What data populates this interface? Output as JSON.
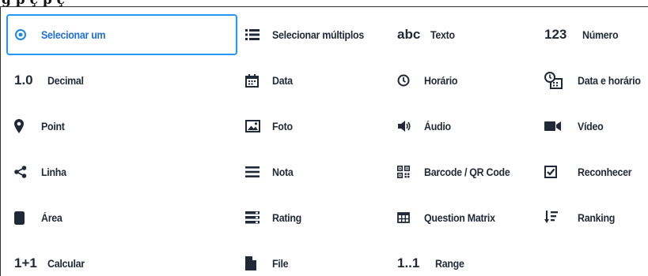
{
  "heading": "g                   p ç   p                     ç",
  "fields": [
    {
      "label": "Selecionar um",
      "icon": "radio-selected-icon",
      "selected": true
    },
    {
      "label": "Selecionar múltiplos",
      "icon": "list-icon"
    },
    {
      "label": "Texto",
      "icon": "text-abc-icon",
      "icon_text": "abc"
    },
    {
      "label": "Número",
      "icon": "number-123-icon",
      "icon_text": "123"
    },
    {
      "label": "Decimal",
      "icon": "decimal-icon",
      "icon_text": "1.0"
    },
    {
      "label": "Data",
      "icon": "calendar-icon"
    },
    {
      "label": "Horário",
      "icon": "clock-icon"
    },
    {
      "label": "Data e horário",
      "icon": "calendar-clock-icon"
    },
    {
      "label": "Point",
      "icon": "map-pin-icon"
    },
    {
      "label": "Foto",
      "icon": "photo-icon"
    },
    {
      "label": "Áudio",
      "icon": "speaker-icon"
    },
    {
      "label": "Vídeo",
      "icon": "video-camera-icon"
    },
    {
      "label": "Linha",
      "icon": "share-line-icon"
    },
    {
      "label": "Nota",
      "icon": "note-lines-icon"
    },
    {
      "label": "Barcode / QR Code",
      "icon": "qr-code-icon"
    },
    {
      "label": "Reconhecer",
      "icon": "checkbox-icon"
    },
    {
      "label": "Área",
      "icon": "area-shape-icon"
    },
    {
      "label": "Rating",
      "icon": "rating-bars-icon"
    },
    {
      "label": "Question Matrix",
      "icon": "table-grid-icon"
    },
    {
      "label": "Ranking",
      "icon": "ranking-sort-icon"
    },
    {
      "label": "Calcular",
      "icon": "calculate-icon",
      "icon_text": "1+1"
    },
    {
      "label": "File",
      "icon": "file-icon"
    },
    {
      "label": "Range",
      "icon": "range-icon",
      "icon_text": "1..1"
    }
  ],
  "colors": {
    "accent": "#2196f3",
    "text": "#1f2937"
  }
}
